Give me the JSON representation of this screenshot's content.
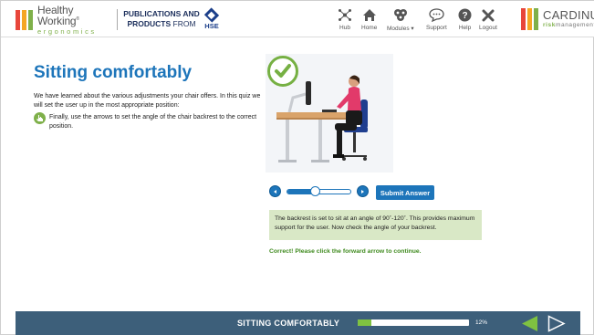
{
  "header": {
    "logo_left": {
      "line1": "Healthy Working",
      "mark": "®",
      "line2": "ergonomics",
      "bar_colors": [
        "#e8463b",
        "#f5a623",
        "#7fb04a"
      ]
    },
    "publications": {
      "line1": "PUBLICATIONS AND",
      "line2_bold": "PRODUCTS",
      "line2_rest": " FROM"
    },
    "hse_label": "HSE",
    "nav": [
      {
        "label": "Hub",
        "icon": "hub-icon"
      },
      {
        "label": "Home",
        "icon": "home-icon"
      },
      {
        "label": "Modules",
        "icon": "modules-icon"
      },
      {
        "label": "Support",
        "icon": "support-icon"
      },
      {
        "label": "Help",
        "icon": "help-icon"
      },
      {
        "label": "Logout",
        "icon": "logout-icon"
      }
    ],
    "logo_right": {
      "line1": "CARDINUS",
      "line2_bold": "risk",
      "line2_rest": "management",
      "bar_colors": [
        "#e8463b",
        "#f5a623",
        "#7fb04a"
      ]
    }
  },
  "content": {
    "title": "Sitting comfortably",
    "intro": "We have learned about the various adjustments your chair offers. In this quiz we will set the user up in the most appropriate position:",
    "instruction": "Finally, use the arrows to set the angle of the chair backrest to the correct position.",
    "slider_value": 0.45,
    "submit_label": "Submit Answer",
    "feedback": "The backrest is set to sit at an angle of 90˚-120˚. This provides maximum support for the user. Now check the angle of your backrest.",
    "correct_message": "Correct! Please click the forward arrow to continue."
  },
  "footer": {
    "section_title": "SITTING COMFORTABLY",
    "progress": 0.12,
    "progress_label": "12%"
  },
  "colors": {
    "accent_blue": "#1d75ba",
    "green": "#7fb04a",
    "footer": "#3d5f7a",
    "feedback_bg": "#d9e8c6"
  }
}
